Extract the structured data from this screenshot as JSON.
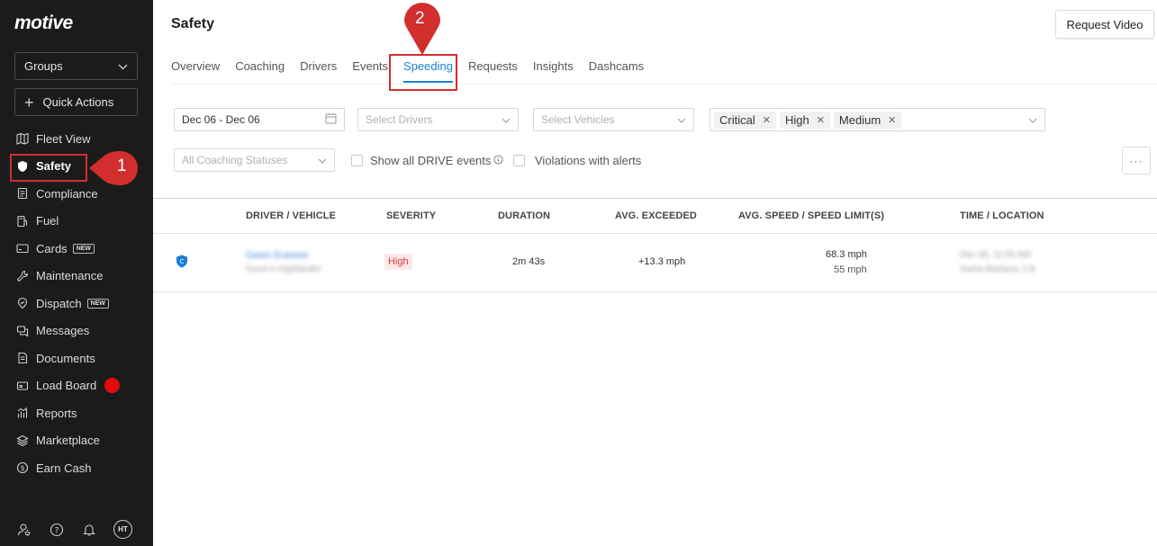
{
  "sidebar": {
    "logo": "motive",
    "groups_label": "Groups",
    "quick_actions_label": "Quick Actions",
    "items": [
      {
        "label": "Fleet View",
        "icon": "map-icon"
      },
      {
        "label": "Safety",
        "icon": "shield-icon",
        "active": true
      },
      {
        "label": "Compliance",
        "icon": "clipboard-icon"
      },
      {
        "label": "Fuel",
        "icon": "fuel-icon"
      },
      {
        "label": "Cards",
        "icon": "card-icon",
        "badge": "NEW"
      },
      {
        "label": "Maintenance",
        "icon": "wrench-icon"
      },
      {
        "label": "Dispatch",
        "icon": "dispatch-icon",
        "badge": "NEW"
      },
      {
        "label": "Messages",
        "icon": "messages-icon"
      },
      {
        "label": "Documents",
        "icon": "document-icon"
      },
      {
        "label": "Load Board",
        "icon": "truck-icon",
        "dot": true
      },
      {
        "label": "Reports",
        "icon": "chart-icon"
      },
      {
        "label": "Marketplace",
        "icon": "layers-icon"
      },
      {
        "label": "Earn Cash",
        "icon": "dollar-icon"
      }
    ],
    "avatar_initials": "HT"
  },
  "callouts": {
    "one": "1",
    "two": "2"
  },
  "header": {
    "title": "Safety",
    "request_video_label": "Request Video"
  },
  "tabs": [
    "Overview",
    "Coaching",
    "Drivers",
    "Events",
    "Speeding",
    "Requests",
    "Insights",
    "Dashcams"
  ],
  "active_tab": "Speeding",
  "filters": {
    "date_range": "Dec 06 - Dec 06",
    "drivers_placeholder": "Select Drivers",
    "vehicles_placeholder": "Select Vehicles",
    "severity_chips": [
      "Critical",
      "High",
      "Medium"
    ],
    "coaching_placeholder": "All Coaching Statuses",
    "show_drive_label": "Show all DRIVE events",
    "violations_label": "Violations with alerts"
  },
  "table": {
    "headers": [
      "DRIVER / VEHICLE",
      "SEVERITY",
      "DURATION",
      "AVG. EXCEEDED",
      "AVG. SPEED / SPEED LIMIT(S)",
      "TIME / LOCATION"
    ],
    "row": {
      "driver": "Gavin Everest",
      "vehicle": "Gavin's Highlander",
      "severity": "High",
      "duration": "2m 43s",
      "avg_exceeded": "+13.3 mph",
      "avg_speed": "68.3 mph",
      "speed_limit": "55 mph",
      "time": "Dec 06, 11:06 AM",
      "location": "Santa Barbara, CA"
    }
  },
  "colors": {
    "accent": "#1b7fd6",
    "callout": "#d22e2e",
    "sidebar_bg": "#1b1b1b"
  }
}
